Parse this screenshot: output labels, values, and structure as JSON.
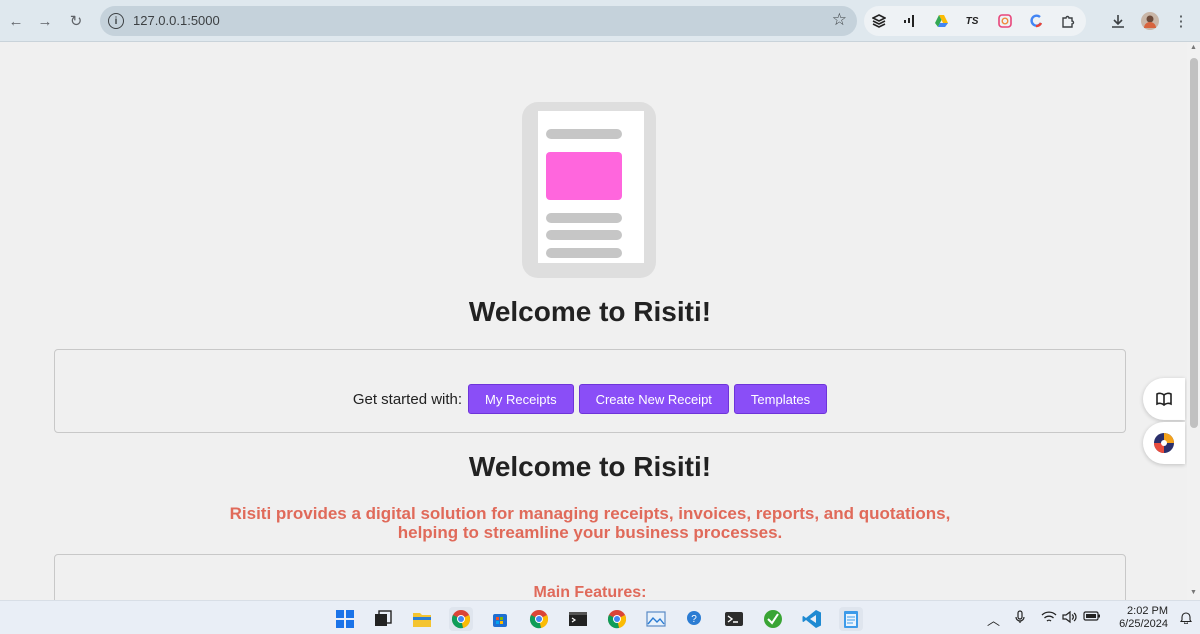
{
  "browser": {
    "url": "127.0.0.1:5000",
    "extensions": [
      "layers-icon",
      "analytics-icon",
      "drive-icon",
      "extension-icon",
      "instagram-icon",
      "color-icon",
      "puzzle-icon"
    ]
  },
  "hero": {
    "title": "Welcome to Risiti!",
    "illustration_accent": "#ff66dd"
  },
  "get_started": {
    "label": "Get started with:",
    "buttons": [
      "My Receipts",
      "Create New Receipt",
      "Templates"
    ],
    "button_color": "#8a4ef7"
  },
  "about": {
    "title": "Welcome to Risiti!",
    "tagline_line1": "Risiti provides a digital solution for managing receipts, invoices, reports, and quotations,",
    "tagline_line2": "helping to streamline your business processes.",
    "accent_color": "#e06a5a"
  },
  "features": {
    "title": "Main Features:"
  },
  "taskbar": {
    "time": "2:02 PM",
    "date": "6/25/2024"
  }
}
